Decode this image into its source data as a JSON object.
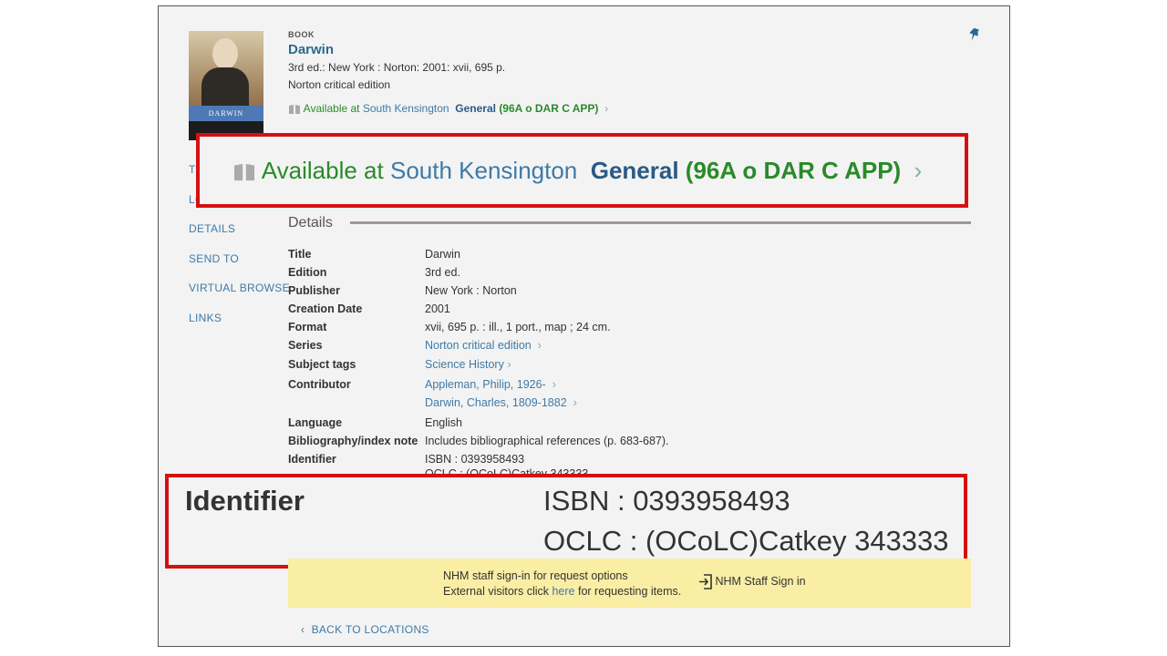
{
  "record": {
    "type": "BOOK",
    "title": "Darwin",
    "line1": "3rd ed.: New York : Norton: 2001: xvii, 695 p.",
    "line2": "Norton critical edition",
    "cover_text": "DARWIN",
    "availability": {
      "prefix": "Available at",
      "library": "South Kensington",
      "location": "General",
      "call_number": "(96A o DAR C APP)"
    }
  },
  "callout_top": {
    "prefix": "Available at",
    "library": "South Kensington",
    "location": "General",
    "call_number": "(96A o DAR C APP)"
  },
  "nav": {
    "partial_top": "TO",
    "partial_loc": "LO",
    "details": "DETAILS",
    "send_to": "SEND TO",
    "virtual_browse": "VIRTUAL BROWSE",
    "links": "LINKS"
  },
  "details": {
    "heading": "Details",
    "rows": [
      {
        "label": "Title",
        "value": "Darwin"
      },
      {
        "label": "Edition",
        "value": "3rd ed."
      },
      {
        "label": "Publisher",
        "value": "New York : Norton"
      },
      {
        "label": "Creation Date",
        "value": "2001"
      },
      {
        "label": "Format",
        "value": "xvii, 695 p. : ill., 1 port., map ; 24 cm."
      },
      {
        "label": "Series",
        "value": "Norton critical edition"
      },
      {
        "label": "Subject tags",
        "value": "Science History"
      },
      {
        "label": "Contributor",
        "value": "Appleman, Philip, 1926-"
      },
      {
        "label": "",
        "value": "Darwin, Charles, 1809-1882"
      },
      {
        "label": "Language",
        "value": "English"
      },
      {
        "label": "Bibliography/index note",
        "value": "Includes bibliographical references (p. 683-687)."
      },
      {
        "label": "Identifier",
        "value": "ISBN : 0393958493"
      },
      {
        "label": "",
        "value": "OCLC : (OCoLC)Catkey 343333"
      }
    ]
  },
  "callout_bottom": {
    "label": "Identifier",
    "isbn": "ISBN : 0393958493",
    "oclc": "OCLC : (OCoLC)Catkey 343333"
  },
  "signin": {
    "line1": "NHM staff sign-in for request options",
    "line2_pre": "External visitors click",
    "line2_link": "here",
    "line2_post": "for requesting items.",
    "button": "NHM Staff Sign in"
  },
  "back": "BACK TO LOCATIONS",
  "icons": {
    "pin": "pin-icon",
    "book": "book-icon",
    "chevron": "chevron-right-icon",
    "back": "chevron-left-icon",
    "signin": "sign-in-icon"
  },
  "colors": {
    "callout_border": "#d61010",
    "available": "#2a8a2a",
    "link": "#3d7aa8",
    "banner": "#faeea5"
  }
}
